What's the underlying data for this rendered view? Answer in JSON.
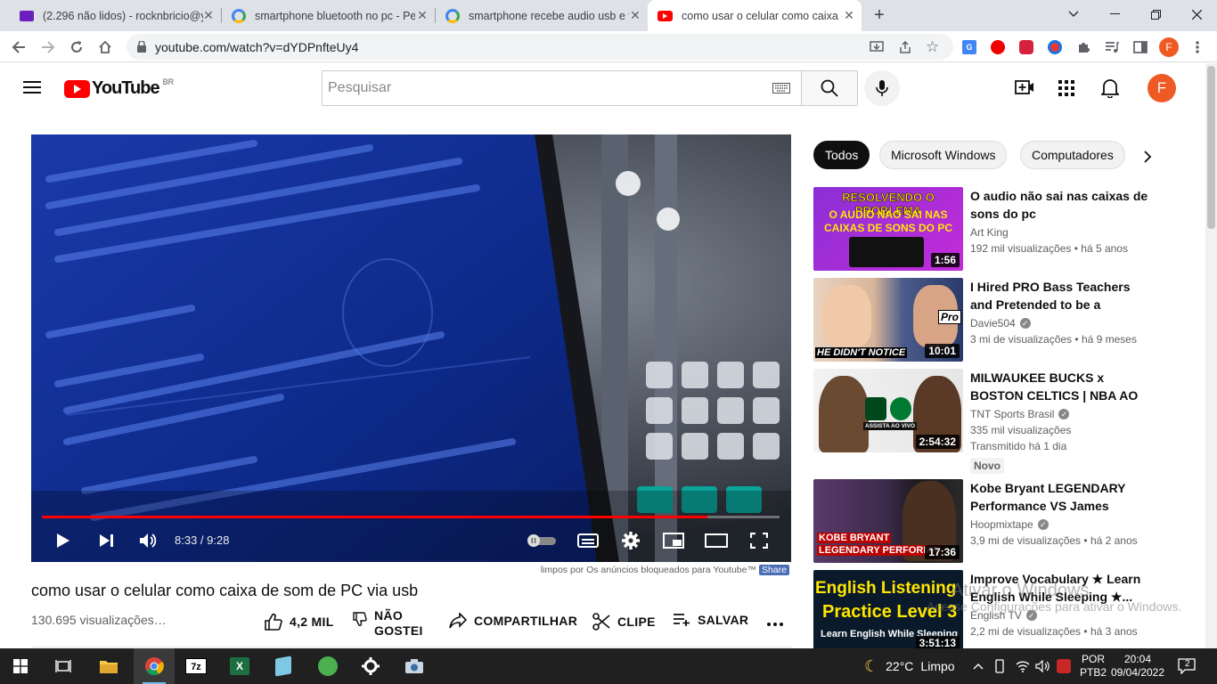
{
  "browser": {
    "tabs": [
      {
        "title": "(2.296 não lidos) - rocknbricio@y",
        "icon": "mail-icon"
      },
      {
        "title": "smartphone bluetooth no pc - Pe",
        "icon": "google-icon"
      },
      {
        "title": "smartphone recebe audio usb e t",
        "icon": "google-icon"
      },
      {
        "title": "como usar o celular como caixa d",
        "icon": "youtube-icon"
      }
    ],
    "url": "youtube.com/watch?v=dYDPnfteUy4",
    "profile_initial": "F"
  },
  "youtube": {
    "logo_text": "YouTube",
    "country": "BR",
    "search_placeholder": "Pesquisar",
    "avatar_initial": "F"
  },
  "player": {
    "current_time": "8:33",
    "time_separator": " / ",
    "duration": "9:28",
    "progress": 0.902,
    "ad_note": "limpos por Os anúncios bloqueados para Youtube™",
    "share_label": "Share"
  },
  "video": {
    "title": "como usar o celular como caixa de som de PC via usb",
    "views": "130.695 visualizações…",
    "likes": "4,2 MIL",
    "dislike_label_1": "NÃO",
    "dislike_label_2": "GOSTEI",
    "share": "COMPARTILHAR",
    "clip": "CLIPE",
    "save": "SALVAR"
  },
  "chips": [
    "Todos",
    "Microsoft Windows",
    "Computadores"
  ],
  "recommendations": [
    {
      "title": "O audio não sai nas caixas de sons do pc",
      "channel": "Art King",
      "verified": false,
      "views": "192 mil visualizações",
      "age": "há 5 anos",
      "duration": "1:56",
      "thumb_text": [
        "RESOLVENDO O PROBLEMA",
        "O AUDIO NAO SAI NAS",
        "CAIXAS DE SONS DO PC"
      ]
    },
    {
      "title": "I Hired PRO Bass Teachers and Pretended to be a BEGINNER...",
      "channel": "Davie504",
      "verified": true,
      "views": "3 mi de visualizações",
      "age": "há 9 meses",
      "duration": "10:01",
      "thumb_text": [
        "HE DIDN'T NOTICE",
        "Pro"
      ]
    },
    {
      "title": "MILWAUKEE BUCKS x BOSTON CELTICS | NBA AO VIVO E CO...",
      "channel": "TNT Sports Brasil",
      "verified": true,
      "views": "335 mil visualizações",
      "age": "Transmitido há 1 dia",
      "badge": "Novo",
      "duration": "2:54:32",
      "thumb_text": [
        "ASSISTA AO VIVO"
      ]
    },
    {
      "title": "Kobe Bryant LEGENDARY Performance VS James Harde...",
      "channel": "Hoopmixtape",
      "verified": true,
      "views": "3,9 mi de visualizações",
      "age": "há 2 anos",
      "duration": "17:36",
      "thumb_text": [
        "KOBE BRYANT",
        "LEGENDARY PERFORMA"
      ]
    },
    {
      "title": "Improve Vocabulary ★ Learn English While Sleeping ★...",
      "channel": "English TV",
      "verified": true,
      "views": "2,2 mi de visualizações",
      "age": "há 3 anos",
      "duration": "3:51:13",
      "thumb_text": [
        "English Listening",
        "Practice Level 3",
        "Learn English While Sleeping"
      ]
    }
  ],
  "watermark": {
    "line1": "Ativar o Windows",
    "line2": "Acesse Configurações para ativar o Windows."
  },
  "taskbar": {
    "weather_temp": "22°C",
    "weather_desc": "Limpo",
    "lang_1": "POR",
    "lang_2": "PTB2",
    "time": "20:04",
    "date": "09/04/2022",
    "notifications": "2"
  },
  "colors": {
    "youtube_red": "#ff0000",
    "profile_orange": "#ef5a24",
    "taskbar_bg": "#202020"
  }
}
